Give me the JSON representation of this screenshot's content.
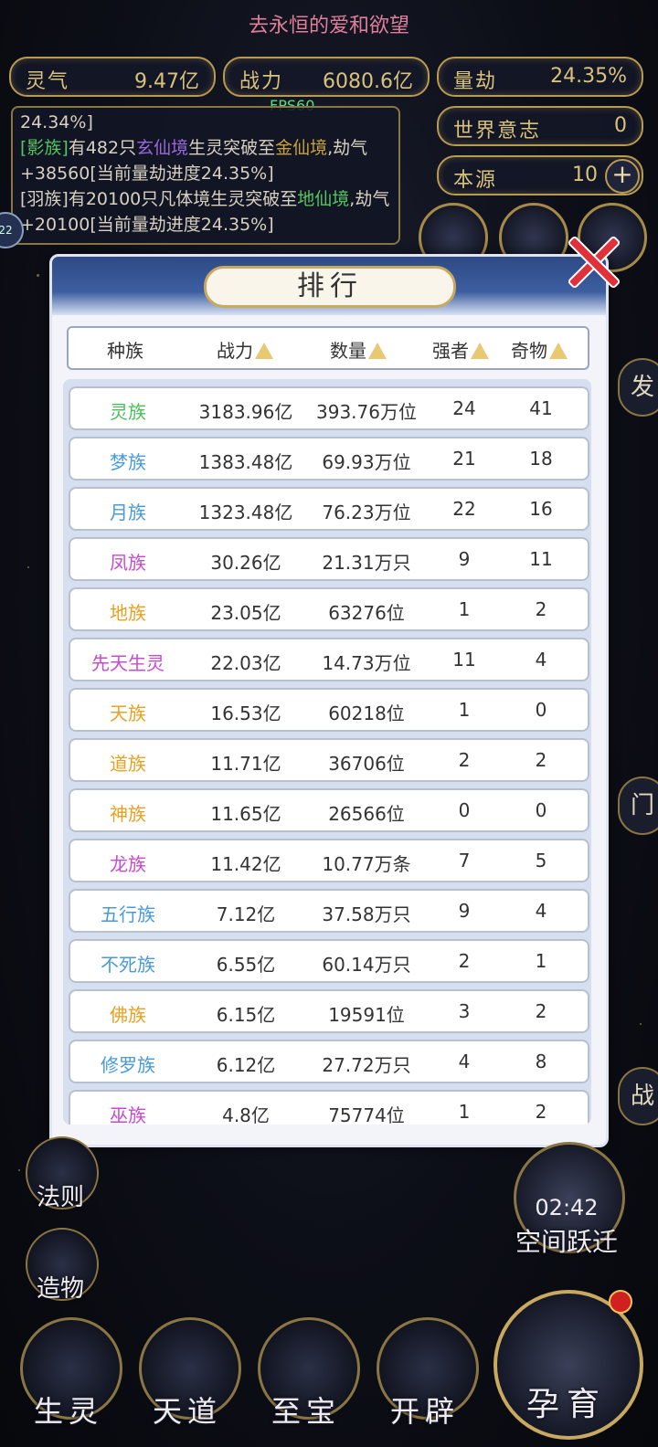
{
  "header": {
    "title": "去永恒的爱和欲望",
    "fps": "FPS60"
  },
  "stats": {
    "lingqi": {
      "label": "灵气",
      "value": "9.47亿"
    },
    "zhanli": {
      "label": "战力",
      "value": "6080.6亿"
    },
    "liangjie": {
      "label": "量劫",
      "value": "24.35%"
    },
    "shijie": {
      "label": "世界意志",
      "value": "0"
    },
    "benyuan": {
      "label": "本源",
      "value": "10"
    }
  },
  "side_badge": "22",
  "log": {
    "line0": "24.34%]",
    "entry1": {
      "race": "[影族]",
      "t1": "有482只",
      "realm1": "玄仙境",
      "t2": "生灵突破至",
      "realm2": "金仙境",
      "t3": ",劫气+38560[当前量劫进度24.35%]"
    },
    "entry2": {
      "race": "[羽族]",
      "t1": "有20100只凡体境生灵突破至",
      "realm": "地仙境",
      "t2": ",劫气+20100[当前量劫进度24.35%]"
    }
  },
  "panel": {
    "title": "排行",
    "columns": {
      "race": "种族",
      "power": "战力",
      "count": "数量",
      "strong": "强者",
      "rare": "奇物"
    },
    "rows": [
      {
        "race": "灵族",
        "color": "#4cbf5a",
        "power": "3183.96亿",
        "count": "393.76万位",
        "strong": "24",
        "rare": "41"
      },
      {
        "race": "梦族",
        "color": "#4a9ad8",
        "power": "1383.48亿",
        "count": "69.93万位",
        "strong": "21",
        "rare": "18"
      },
      {
        "race": "月族",
        "color": "#4a9ad8",
        "power": "1323.48亿",
        "count": "76.23万位",
        "strong": "22",
        "rare": "16"
      },
      {
        "race": "凤族",
        "color": "#c84ad0",
        "power": "30.26亿",
        "count": "21.31万只",
        "strong": "9",
        "rare": "11"
      },
      {
        "race": "地族",
        "color": "#e8a020",
        "power": "23.05亿",
        "count": "63276位",
        "strong": "1",
        "rare": "2"
      },
      {
        "race": "先天生灵",
        "color": "#c84ad0",
        "power": "22.03亿",
        "count": "14.73万位",
        "strong": "11",
        "rare": "4"
      },
      {
        "race": "天族",
        "color": "#e8a020",
        "power": "16.53亿",
        "count": "60218位",
        "strong": "1",
        "rare": "0"
      },
      {
        "race": "道族",
        "color": "#e8a020",
        "power": "11.71亿",
        "count": "36706位",
        "strong": "2",
        "rare": "2"
      },
      {
        "race": "神族",
        "color": "#e8a020",
        "power": "11.65亿",
        "count": "26566位",
        "strong": "0",
        "rare": "0"
      },
      {
        "race": "龙族",
        "color": "#c84ad0",
        "power": "11.42亿",
        "count": "10.77万条",
        "strong": "7",
        "rare": "5"
      },
      {
        "race": "五行族",
        "color": "#4a9ad8",
        "power": "7.12亿",
        "count": "37.58万只",
        "strong": "9",
        "rare": "4"
      },
      {
        "race": "不死族",
        "color": "#4a9ad8",
        "power": "6.55亿",
        "count": "60.14万只",
        "strong": "2",
        "rare": "1"
      },
      {
        "race": "佛族",
        "color": "#e8a020",
        "power": "6.15亿",
        "count": "19591位",
        "strong": "3",
        "rare": "2"
      },
      {
        "race": "修罗族",
        "color": "#4a9ad8",
        "power": "6.12亿",
        "count": "27.72万只",
        "strong": "4",
        "rare": "8"
      },
      {
        "race": "巫族",
        "color": "#c84ad0",
        "power": "4.8亿",
        "count": "75774位",
        "strong": "1",
        "rare": "2"
      }
    ]
  },
  "left_buttons": {
    "law": "法则",
    "create": "造物"
  },
  "timer": {
    "time": "02:42",
    "label": "空间跃迁"
  },
  "bottom": {
    "life": "生灵",
    "dao": "天道",
    "treasure": "至宝",
    "open": "开辟",
    "nurture": "孕育"
  },
  "right_edge": {
    "fa": "发",
    "men": "门",
    "zhan": "战"
  }
}
